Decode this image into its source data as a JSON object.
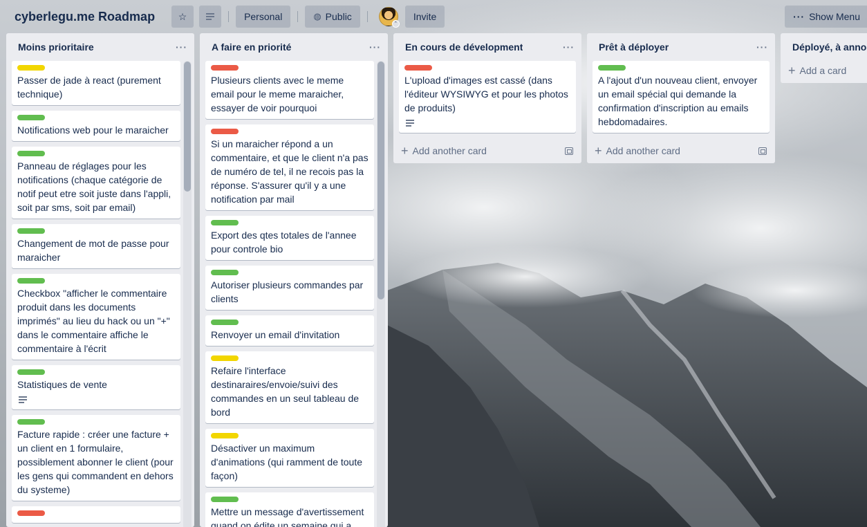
{
  "board": {
    "title": "cyberlegu.me Roadmap",
    "team": "Personal",
    "visibility": "Public",
    "invite": "Invite",
    "show_menu": "Show Menu"
  },
  "colors": {
    "green": "#61bd4f",
    "red": "#eb5a46",
    "yellow": "#f2d600",
    "list_bg": "#ebecf0"
  },
  "lists": [
    {
      "title": "Moins prioritaire",
      "cards": [
        {
          "label": "yellow",
          "title": "Passer de jade à react (purement technique)"
        },
        {
          "label": "green",
          "title": "Notifications web pour le maraicher"
        },
        {
          "label": "green",
          "title": "Panneau de réglages pour les notifications (chaque catégorie de notif peut etre soit juste dans l'appli, soit par sms, soit par email)"
        },
        {
          "label": "green",
          "title": "Changement de mot de passe pour maraicher"
        },
        {
          "label": "green",
          "title": "Checkbox \"afficher le commentaire produit dans les documents imprimés\" au lieu du hack ou un \"+\" dans le commentaire affiche le commentaire à l'écrit"
        },
        {
          "label": "green",
          "title": "Statistiques de vente",
          "has_description": true
        },
        {
          "label": "green",
          "title": "Facture rapide : créer une facture + un client en 1 formulaire, possiblement abonner le client (pour les gens qui commandent en dehors du systeme)"
        },
        {
          "label": "red",
          "title": ""
        }
      ]
    },
    {
      "title": "A faire en priorité",
      "cards": [
        {
          "label": "red",
          "title": "Plusieurs clients avec le meme email pour le meme maraicher, essayer de voir pourquoi"
        },
        {
          "label": "red",
          "title": "Si un maraicher répond a un commentaire, et que le client n'a pas de numéro de tel, il ne recois pas la réponse. S'assurer qu'il y a une notification par mail"
        },
        {
          "label": "green",
          "title": "Export des qtes totales de l'annee pour controle bio"
        },
        {
          "label": "green",
          "title": "Autoriser plusieurs commandes par clients"
        },
        {
          "label": "green",
          "title": "Renvoyer un email d'invitation"
        },
        {
          "label": "yellow",
          "title": "Refaire l'interface destinaraires/envoie/suivi des commandes en un seul tableau de bord"
        },
        {
          "label": "yellow",
          "title": "Désactiver un maximum d'animations (qui ramment de toute façon)"
        },
        {
          "label": "green",
          "title": "Mettre un message d'avertissement quand on édite un semaine qui a"
        }
      ]
    },
    {
      "title": "En cours de dévelopment",
      "cards": [
        {
          "label": "red",
          "title": "L'upload d'images est cassé (dans l'éditeur WYSIWYG et pour les photos de produits)",
          "has_description": true
        }
      ],
      "add_label": "Add another card"
    },
    {
      "title": "Prêt à déployer",
      "cards": [
        {
          "label": "green",
          "title": "A l'ajout d'un nouveau client, envoyer un email spécial qui demande la confirmation d'inscription au emails hebdomadaires."
        }
      ],
      "add_label": "Add another card"
    },
    {
      "title": "Déployé, à annoncer",
      "cards": [],
      "add_label": "Add a card"
    }
  ]
}
